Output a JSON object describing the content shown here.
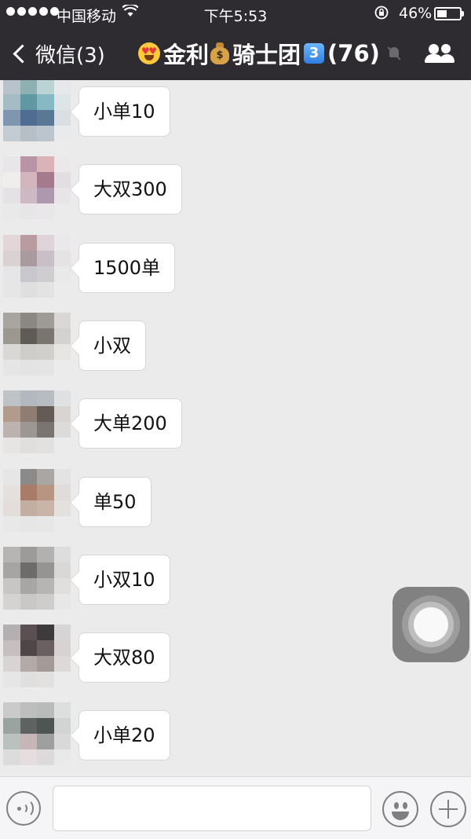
{
  "status_bar": {
    "carrier": "中国移动",
    "time": "下午5:53",
    "battery_percent": "46%",
    "battery_level": 0.46,
    "signal_bars": 5,
    "icons": [
      "signal-dots-icon",
      "wifi-icon",
      "orientation-lock-icon",
      "battery-icon"
    ]
  },
  "nav": {
    "back_label": "微信(3)",
    "title": {
      "prefix_emoji": "smiling-face-with-heart-eyes-icon",
      "part1": "金利",
      "mid_emoji": "money-bag-icon",
      "part2": "骑士团",
      "keycap": "3",
      "member_count": "(76)"
    },
    "muted": true,
    "right_icon": "group-members-icon"
  },
  "messages": [
    {
      "text": "小单10",
      "avatar": [
        "#b7c2cb",
        "#8fb0b3",
        "#bcd3d3",
        "#e6e9ec",
        "#a6bcc4",
        "#5f98a2",
        "#86b9c2",
        "#dde5e8",
        "#7f95b0",
        "#4f6c93",
        "#5a7896",
        "#d9dee3",
        "#c4ccd3",
        "#b5bfc8",
        "#bcc5ce",
        "#e8eaec"
      ]
    },
    {
      "text": "大双300",
      "avatar": [
        "#e8e6e8",
        "#b994a7",
        "#d9b3b5",
        "#ebe8ea",
        "#f0eeec",
        "#d2b5bd",
        "#a57a8c",
        "#e2dde0",
        "#e4e2e4",
        "#cdb9c4",
        "#ad98b0",
        "#e7e5e7",
        "#eae9ea",
        "#e7e5e7",
        "#e9e7e9",
        "#ebebeb"
      ]
    },
    {
      "text": "1500单",
      "avatar": [
        "#e2d6d8",
        "#b99c9f",
        "#ddd3d8",
        "#eae8ea",
        "#dad1d3",
        "#a99aa0",
        "#c8c0c6",
        "#e6e3e5",
        "#e6e6e8",
        "#c8c7ce",
        "#cfcdd0",
        "#e9e9e9",
        "#e6e6e6",
        "#dfdfdf",
        "#e3e3e3",
        "#ebebeb"
      ]
    },
    {
      "text": "小双",
      "avatar": [
        "#a8a59f",
        "#8b8782",
        "#9e9a95",
        "#d8d7d5",
        "#9c978f",
        "#5f5b56",
        "#7a756f",
        "#d4d2d0",
        "#d9d8d6",
        "#cfcdca",
        "#d1cfcc",
        "#e6e5e4",
        "#e5e5e5",
        "#e3e3e3",
        "#e4e4e4",
        "#ebebeb"
      ]
    },
    {
      "text": "大单200",
      "avatar": [
        "#c0c3c6",
        "#b2b8bd",
        "#b6bcc1",
        "#dfe1e3",
        "#b29a8c",
        "#8f7c72",
        "#645b57",
        "#d8d4d2",
        "#bcb3ae",
        "#9d9793",
        "#7b7571",
        "#dddbd9",
        "#e6e5e4",
        "#e0dfde",
        "#e2e1e0",
        "#ebebeb"
      ]
    },
    {
      "text": "单50",
      "avatar": [
        "#e6e6e6",
        "#8c8a89",
        "#a9a6a4",
        "#e4e3e3",
        "#e3e0de",
        "#a87c68",
        "#b89482",
        "#e1dcd9",
        "#e3dedb",
        "#c3aea4",
        "#c9b4a8",
        "#e4e0dd",
        "#e8e8e8",
        "#e6e6e6",
        "#e7e7e7",
        "#ebebeb"
      ]
    },
    {
      "text": "小双10",
      "avatar": [
        "#b6b5b3",
        "#9c9b99",
        "#b2b1af",
        "#dedddd",
        "#a6a5a3",
        "#6d6c6a",
        "#959492",
        "#d9d8d7",
        "#c7c6c4",
        "#a7a6a4",
        "#b6b5b3",
        "#e0dfde",
        "#d4d3d2",
        "#c9c8c7",
        "#cecdcc",
        "#e7e7e7"
      ]
    },
    {
      "text": "大双80",
      "avatar": [
        "#b4b0b1",
        "#5a5052",
        "#3d3a3c",
        "#d6d4d5",
        "#c7bfbf",
        "#4f4647",
        "#6b6061",
        "#d7d3d3",
        "#d8d4d3",
        "#b3aaa8",
        "#a49b99",
        "#dcd9d8",
        "#e7e6e6",
        "#e1dfde",
        "#e3e1e0",
        "#ebebeb"
      ]
    },
    {
      "text": "小单20",
      "avatar": [
        "#c9cac9",
        "#bdbfbe",
        "#b8bbba",
        "#dddede",
        "#9aa3a0",
        "#5e6260",
        "#4e5654",
        "#d2d4d3",
        "#b9c2bf",
        "#c7b6b7",
        "#9ea09f",
        "#d9d9d9",
        "#dcdcdc",
        "#e6dddf",
        "#dcdada",
        "#e9e9e9"
      ]
    }
  ],
  "input_bar": {
    "text_value": "",
    "left_icon": "voice-input-icon",
    "emoji_icon": "emoji-icon",
    "more_icon": "plus-icon"
  },
  "overlay": {
    "icon": "assistive-touch-icon"
  },
  "colors": {
    "header_bg": "#2e2c31",
    "chat_bg": "#ebebeb",
    "bubble_bg": "#ffffff",
    "input_bar_bg": "#f5f5f7"
  }
}
